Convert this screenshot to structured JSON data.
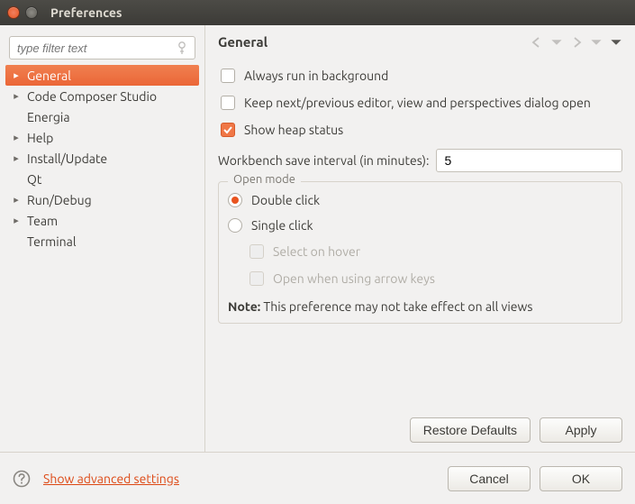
{
  "window": {
    "title": "Preferences"
  },
  "filter": {
    "placeholder": "type filter text"
  },
  "tree": {
    "items": [
      {
        "label": "General",
        "expandable": true,
        "selected": true
      },
      {
        "label": "Code Composer Studio",
        "expandable": true
      },
      {
        "label": "Energia",
        "expandable": false
      },
      {
        "label": "Help",
        "expandable": true
      },
      {
        "label": "Install/Update",
        "expandable": true
      },
      {
        "label": "Qt",
        "expandable": false
      },
      {
        "label": "Run/Debug",
        "expandable": true
      },
      {
        "label": "Team",
        "expandable": true
      },
      {
        "label": "Terminal",
        "expandable": false
      }
    ]
  },
  "pane": {
    "title": "General",
    "checks": {
      "run_bg": {
        "label": "Always run in background",
        "checked": false
      },
      "keep_next_prev": {
        "label": "Keep next/previous editor, view and perspectives dialog open",
        "checked": false
      },
      "show_heap": {
        "label": "Show heap status",
        "checked": true
      }
    },
    "save_interval": {
      "label": "Workbench save interval (in minutes):",
      "value": "5"
    },
    "open_mode": {
      "title": "Open mode",
      "double": "Double click",
      "single": "Single click",
      "selected": "double",
      "select_on_hover": "Select on hover",
      "open_arrow_keys": "Open when using arrow keys",
      "note_label": "Note:",
      "note_text": "This preference may not take effect on all views"
    },
    "buttons": {
      "restore": "Restore Defaults",
      "apply": "Apply"
    }
  },
  "footer": {
    "advanced": "Show advanced settings",
    "cancel": "Cancel",
    "ok": "OK"
  }
}
